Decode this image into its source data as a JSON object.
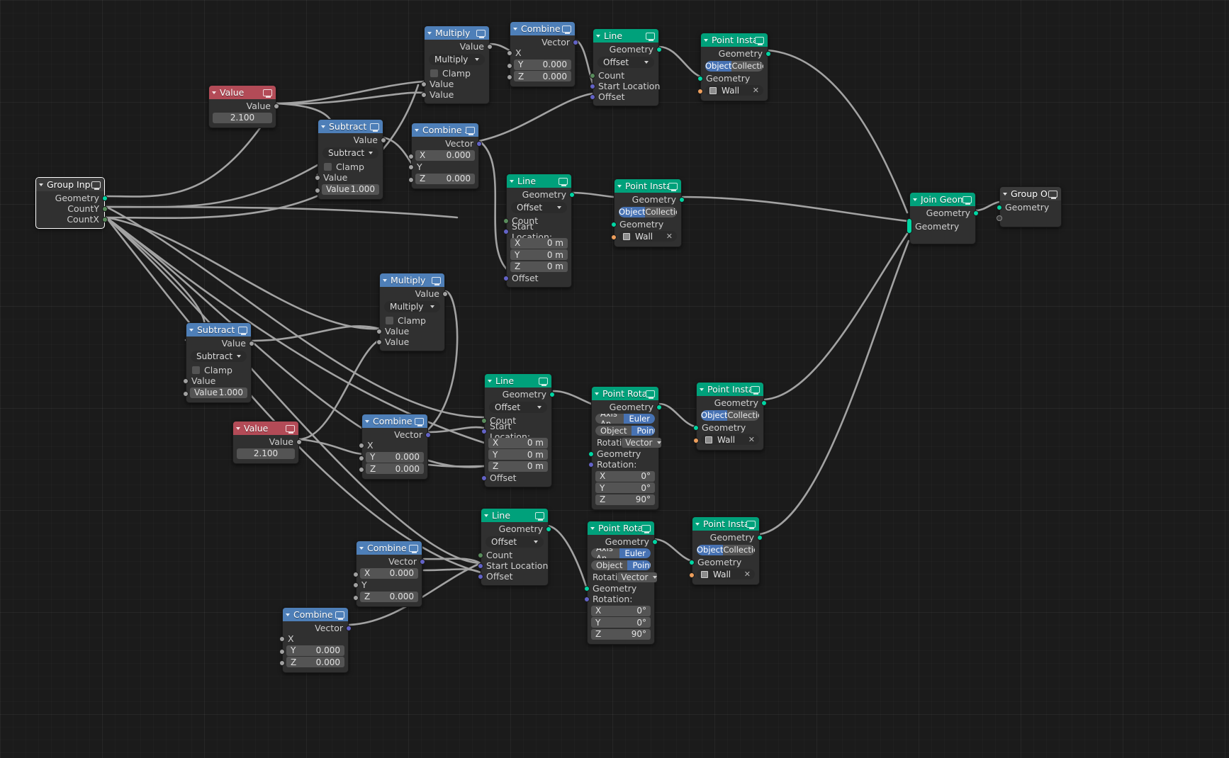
{
  "editor": {
    "name": "blender-geometry-node-editor",
    "background": "#1b1b1b"
  },
  "colors": {
    "geometry_header": "#00a17b",
    "converter_header": "#4e7fb8",
    "input_header": "#b34b57",
    "group_header": "#3b3b3b",
    "toggle_active": "#4772b3",
    "socket_geometry": "#00d6a3",
    "socket_vector": "#6363c7",
    "socket_value": "#a1a1a1",
    "socket_int": "#598c5c",
    "socket_object": "#ed9e5c"
  },
  "labels": {
    "geometry": "Geometry",
    "value": "Value",
    "vector": "Vector",
    "count": "Count",
    "offset": "Offset",
    "start_location": "Start Location",
    "start_location_colon": "Start Location:",
    "rotation_colon": "Rotation:",
    "clamp": "Clamp",
    "x": "X",
    "y": "Y",
    "z": "Z",
    "zero_m": "0 m",
    "zero_deg": "0°",
    "ninety_deg": "90°",
    "zero_000": "0.000",
    "one_000": "1.000",
    "object": "Object",
    "collection": "Collection",
    "point": "Point",
    "euler": "Euler",
    "axis_angle_trunc": "Axis An...",
    "rotation_trunc": "Rotati",
    "vector_mode": "Vector",
    "wall": "Wall",
    "close_x": "✕"
  },
  "nodes": {
    "group_input": {
      "title": "Group Input",
      "outputs": [
        "Geometry",
        "CountY",
        "CountX"
      ]
    },
    "value_top": {
      "title": "Value",
      "output": "Value",
      "field_value": "2.100"
    },
    "value_mid": {
      "title": "Value",
      "output": "Value",
      "field_value": "2.100"
    },
    "multiply_top": {
      "title": "Multiply",
      "output": "Value",
      "operation": "Multiply",
      "clamp": "Clamp",
      "inputs": [
        "Value",
        "Value"
      ]
    },
    "multiply_mid": {
      "title": "Multiply",
      "output": "Value",
      "operation": "Multiply",
      "clamp": "Clamp",
      "inputs": [
        "Value",
        "Value"
      ]
    },
    "subtract_top": {
      "title": "Subtract",
      "output": "Value",
      "operation": "Subtract",
      "clamp": "Clamp",
      "input_label": "Value",
      "field_label": "Value",
      "field_value": "1.000"
    },
    "subtract_mid": {
      "title": "Subtract",
      "output": "Value",
      "operation": "Subtract",
      "clamp": "Clamp",
      "input_label": "Value",
      "field_label": "Value",
      "field_value": "1.000"
    },
    "combine_xyz_1": {
      "title": "Combine XYZ",
      "output": "Vector",
      "x_label": "X",
      "y_label": "Y",
      "y_value": "0.000",
      "z_label": "Z",
      "z_value": "0.000"
    },
    "combine_xyz_2": {
      "title": "Combine XYZ",
      "output": "Vector",
      "x_label": "X",
      "x_value": "0.000",
      "y_label": "Y",
      "z_label": "Z",
      "z_value": "0.000"
    },
    "combine_xyz_3": {
      "title": "Combine XYZ",
      "output": "Vector",
      "x_label": "X",
      "y_label": "Y",
      "y_value": "0.000",
      "z_label": "Z",
      "z_value": "0.000"
    },
    "combine_xyz_4": {
      "title": "Combine XYZ",
      "output": "Vector",
      "x_label": "X",
      "x_value": "0.000",
      "y_label": "Y",
      "z_label": "Z",
      "z_value": "0.000"
    },
    "combine_xyz_5": {
      "title": "Combine XYZ",
      "output": "Vector",
      "x_label": "X",
      "y_label": "Y",
      "y_value": "0.000",
      "z_label": "Z",
      "z_value": "0.000"
    },
    "line_1": {
      "title": "Line",
      "output": "Geometry",
      "mode": "Offset",
      "count": "Count",
      "start_location": "Start Location",
      "offset": "Offset"
    },
    "line_2": {
      "title": "Line",
      "output": "Geometry",
      "mode": "Offset",
      "count": "Count",
      "start_location_label": "Start Location:",
      "x_label": "X",
      "x_value": "0 m",
      "y_label": "Y",
      "y_value": "0 m",
      "z_label": "Z",
      "z_value": "0 m",
      "offset": "Offset"
    },
    "line_3": {
      "title": "Line",
      "output": "Geometry",
      "mode": "Offset",
      "count": "Count",
      "start_location_label": "Start Location:",
      "x_label": "X",
      "x_value": "0 m",
      "y_label": "Y",
      "y_value": "0 m",
      "z_label": "Z",
      "z_value": "0 m",
      "offset": "Offset"
    },
    "line_4": {
      "title": "Line",
      "output": "Geometry",
      "mode": "Offset",
      "count": "Count",
      "start_location": "Start Location",
      "offset": "Offset"
    },
    "point_instance_1": {
      "title": "Point Instance",
      "output": "Geometry",
      "toggle_object": "Object",
      "toggle_collection": "Collection",
      "geometry_input": "Geometry",
      "object_name": "Wall"
    },
    "point_instance_2": {
      "title": "Point Instance",
      "output": "Geometry",
      "toggle_object": "Object",
      "toggle_collection": "Collection",
      "geometry_input": "Geometry",
      "object_name": "Wall"
    },
    "point_instance_3": {
      "title": "Point Instance",
      "output": "Geometry",
      "toggle_object": "Object",
      "toggle_collection": "Collection",
      "geometry_input": "Geometry",
      "object_name": "Wall"
    },
    "point_instance_4": {
      "title": "Point Instance",
      "output": "Geometry",
      "toggle_object": "Object",
      "toggle_collection": "Collection",
      "geometry_input": "Geometry",
      "object_name": "Wall"
    },
    "point_rotate_1": {
      "title": "Point Rotate",
      "output": "Geometry",
      "type_axis": "Axis An...",
      "type_euler": "Euler",
      "space_object": "Object",
      "space_point": "Point",
      "rotation_label": "Rotati",
      "rotation_mode": "Vector",
      "geometry_input": "Geometry",
      "rotation_header": "Rotation:",
      "x_label": "X",
      "x_value": "0°",
      "y_label": "Y",
      "y_value": "0°",
      "z_label": "Z",
      "z_value": "90°"
    },
    "point_rotate_2": {
      "title": "Point Rotate",
      "output": "Geometry",
      "type_axis": "Axis An...",
      "type_euler": "Euler",
      "space_object": "Object",
      "space_point": "Point",
      "rotation_label": "Rotati",
      "rotation_mode": "Vector",
      "geometry_input": "Geometry",
      "rotation_header": "Rotation:",
      "x_label": "X",
      "x_value": "0°",
      "y_label": "Y",
      "y_value": "0°",
      "z_label": "Z",
      "z_value": "90°"
    },
    "join_geometry": {
      "title": "Join Geometry",
      "output": "Geometry",
      "input": "Geometry"
    },
    "group_output": {
      "title": "Group Output",
      "input": "Geometry"
    }
  }
}
